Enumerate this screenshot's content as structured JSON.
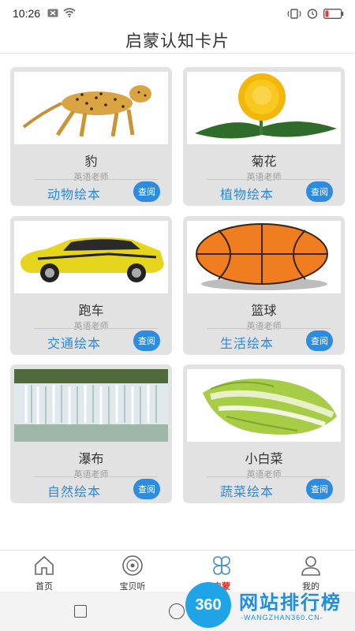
{
  "status_bar": {
    "time": "10:26",
    "icons": [
      "close-box-icon",
      "wifi-icon",
      "vibrate-icon",
      "alarm-icon",
      "battery-low-icon"
    ]
  },
  "header": {
    "title": "启蒙认知卡片"
  },
  "cards": [
    {
      "name": "豹",
      "author": "英语老师",
      "category": "动物绘本",
      "button": "查阅",
      "image": "cheetah-image"
    },
    {
      "name": "菊花",
      "author": "英语老师",
      "category": "植物绘本",
      "button": "查阅",
      "image": "chrysanthemum-image"
    },
    {
      "name": "跑车",
      "author": "英语老师",
      "category": "交通绘本",
      "button": "查阅",
      "image": "sports-car-image"
    },
    {
      "name": "篮球",
      "author": "英语老师",
      "category": "生活绘本",
      "button": "查阅",
      "image": "basketball-image"
    },
    {
      "name": "瀑布",
      "author": "英语老师",
      "category": "自然绘本",
      "button": "查阅",
      "image": "waterfall-image"
    },
    {
      "name": "小白菜",
      "author": "英语老师",
      "category": "蔬菜绘本",
      "button": "查阅",
      "image": "bok-choy-image"
    }
  ],
  "tabs": [
    {
      "label": "首页",
      "icon": "home-icon",
      "active": false
    },
    {
      "label": "宝贝听",
      "icon": "disc-icon",
      "active": false
    },
    {
      "label": "启蒙",
      "icon": "clover-icon",
      "active": true
    },
    {
      "label": "我的",
      "icon": "person-icon",
      "active": false
    }
  ],
  "watermark": {
    "badge": "360",
    "text": "网站排行榜",
    "subtext": "-WANGZHAN360.CN-"
  },
  "colors": {
    "accent": "#2b8ad6",
    "button": "#2c8ce0",
    "active_tab": "#d9322e",
    "card_bg": "#e3e2e2"
  }
}
